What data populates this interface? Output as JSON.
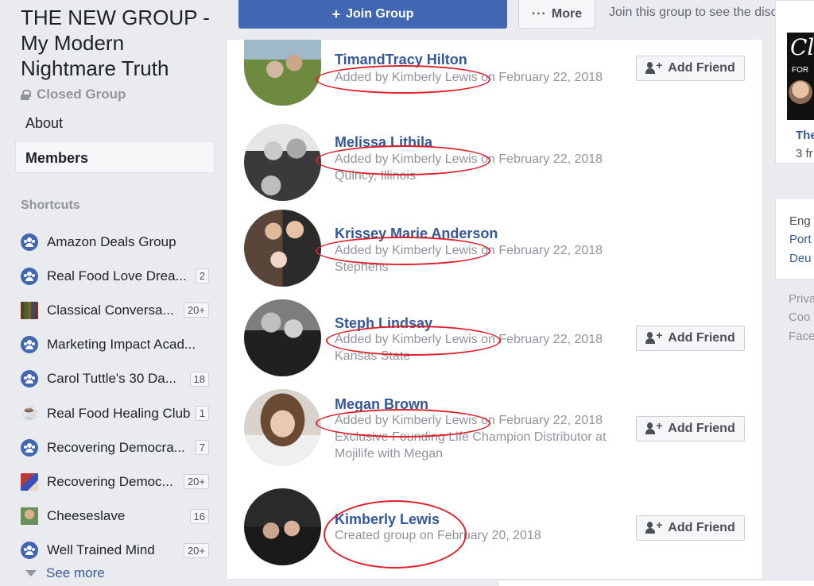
{
  "sidebar": {
    "group_title": "THE NEW GROUP - My Modern Nightmare Truth",
    "privacy": "Closed Group",
    "nav_about": "About",
    "nav_members": "Members",
    "shortcuts_heading": "Shortcuts",
    "shortcuts": [
      {
        "label": "Amazon Deals Group",
        "badge": "",
        "icon": "group-icon"
      },
      {
        "label": "Real Food Love Drea...",
        "badge": "2",
        "icon": "group-icon"
      },
      {
        "label": "Classical Conversa...",
        "badge": "20+",
        "icon": "books-thumbnail"
      },
      {
        "label": "Marketing Impact Acad...",
        "badge": "",
        "icon": "group-icon"
      },
      {
        "label": "Carol Tuttle's 30 Da...",
        "badge": "18",
        "icon": "group-icon"
      },
      {
        "label": "Real Food Healing Club",
        "badge": "1",
        "icon": "coffee-icon"
      },
      {
        "label": "Recovering Democra...",
        "badge": "7",
        "icon": "group-icon"
      },
      {
        "label": "Recovering Democ...",
        "badge": "20+",
        "icon": "flag-thumbnail"
      },
      {
        "label": "Cheeseslave",
        "badge": "16",
        "icon": "profile-thumbnail"
      },
      {
        "label": "Well Trained Mind",
        "badge": "20+",
        "icon": "group-icon"
      }
    ],
    "see_more": "See more"
  },
  "topbar": {
    "join_label": "Join Group",
    "more_label": "More",
    "join_prompt": "Join this group to see the discussio"
  },
  "members": [
    {
      "name": "TimandTracy Hilton",
      "line1": "Added by Kimberly Lewis on February 22, 2018",
      "line2": "",
      "line3": "",
      "add_friend": "Add Friend"
    },
    {
      "name": "Melissa Lithila",
      "line1": "Added by Kimberly Lewis on February 22, 2018",
      "line2": "Quincy, Illinois",
      "line3": "",
      "add_friend": ""
    },
    {
      "name": "Krissey Marie Anderson",
      "line1": "Added by Kimberly Lewis on February 22, 2018",
      "line2": "Stephens",
      "line3": "",
      "add_friend": ""
    },
    {
      "name": "Steph Lindsay",
      "line1": "Added by Kimberly Lewis on February 22, 2018",
      "line2": "Kansas State",
      "line3": "",
      "add_friend": "Add Friend"
    },
    {
      "name": "Megan Brown",
      "line1": "Added by Kimberly Lewis on February 22, 2018",
      "line2": "Exclusive Founding Life Champion Distributor at",
      "line3": "Mojilife with Megan",
      "add_friend": "Add Friend"
    },
    {
      "name": "Kimberly Lewis",
      "line1": "Created group on February 20, 2018",
      "line2": "",
      "line3": "",
      "add_friend": "Add Friend"
    }
  ],
  "right": {
    "card_title": "The",
    "card_sub": "3 fr",
    "card_img_text": "Cl",
    "card_img_sub": "FOR",
    "languages": [
      "Eng",
      "Port",
      "Deu"
    ],
    "footer": [
      "Priva",
      "Coo",
      "Face"
    ]
  },
  "colors": {
    "brand_blue": "#4267b2",
    "link_blue": "#365899",
    "annotation_red": "#e0202a"
  }
}
